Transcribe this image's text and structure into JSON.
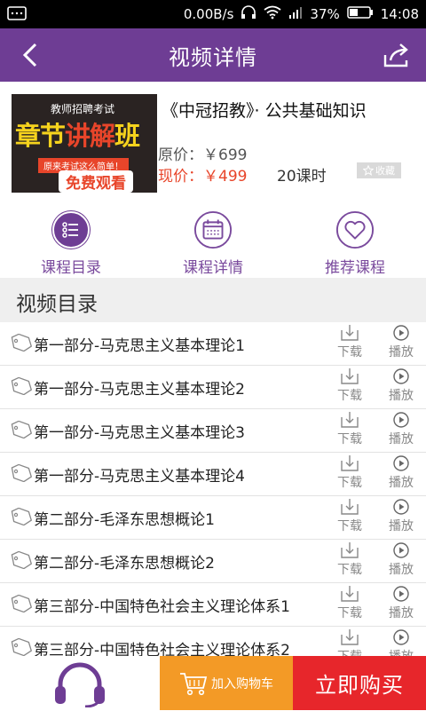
{
  "status_bar": {
    "speed": "0.00B/s",
    "battery": "37%",
    "time": "14:08"
  },
  "header": {
    "title": "视频详情"
  },
  "course": {
    "thumbnail": {
      "line1": "教师招聘考试",
      "line2a": "章节",
      "line2b": "讲解",
      "line2c": "班",
      "line3": "原来考试这么简单！",
      "line4": "免费观看"
    },
    "title": "《中冠招教》· 公共基础知识",
    "original_price": "原价：￥699",
    "current_price": "现价：￥499",
    "lessons": "20课时",
    "favorite_label": "收藏"
  },
  "tabs": [
    {
      "label": "课程目录",
      "icon": "list-icon"
    },
    {
      "label": "课程详情",
      "icon": "calendar-icon"
    },
    {
      "label": "推荐课程",
      "icon": "heart-icon"
    }
  ],
  "section_title": "视频目录",
  "videos": [
    {
      "name": "第一部分-马克思主义基本理论1"
    },
    {
      "name": "第一部分-马克思主义基本理论2"
    },
    {
      "name": "第一部分-马克思主义基本理论3"
    },
    {
      "name": "第一部分-马克思主义基本理论4"
    },
    {
      "name": "第二部分-毛泽东思想概论1"
    },
    {
      "name": "第二部分-毛泽东思想概论2"
    },
    {
      "name": "第三部分-中国特色社会主义理论体系1"
    },
    {
      "name": "第三部分-中国特色社会主义理论体系2"
    }
  ],
  "row_actions": {
    "download_label": "下载",
    "play_label": "播放"
  },
  "bottom": {
    "cart_label": "加入购物车",
    "buy_label": "立即购买"
  },
  "colors": {
    "brand_purple": "#6e3d94",
    "price_red": "#e8452a",
    "cart_orange": "#f39a26",
    "buy_red": "#e7262b"
  }
}
